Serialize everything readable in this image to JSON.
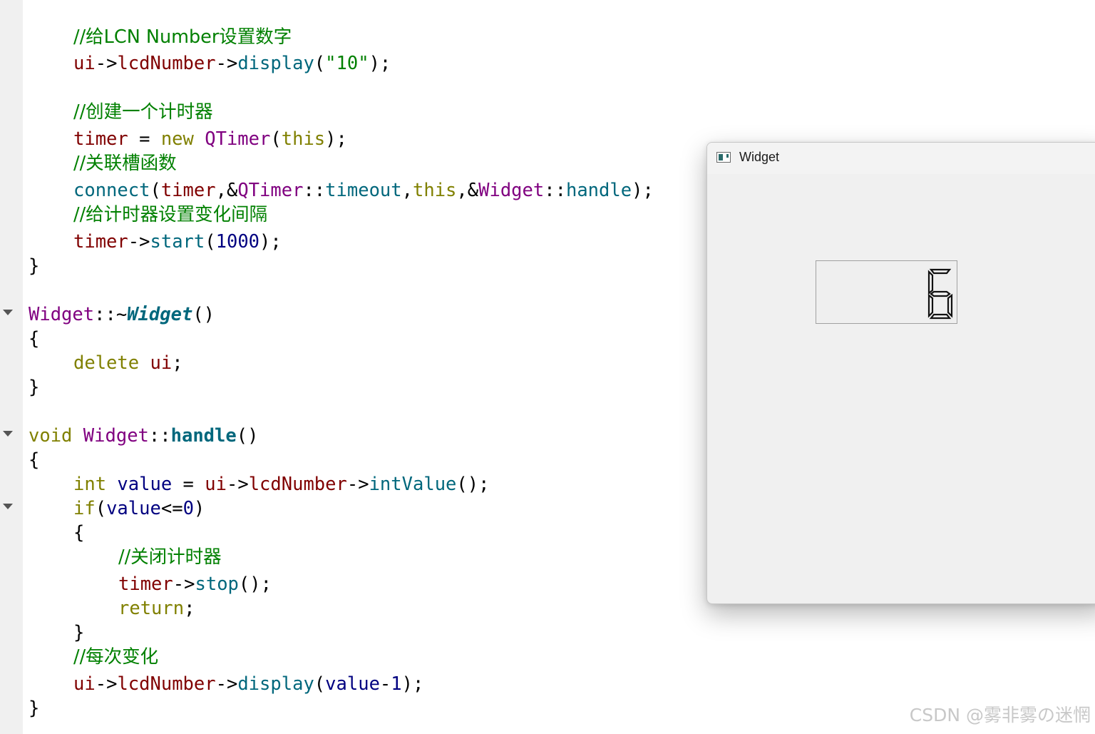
{
  "editor": {
    "comment_set_lcd": "//给LCN Number设置数字",
    "comment_create_timer": "//创建一个计时器",
    "comment_connect": "//关联槽函数",
    "comment_interval": "//给计时器设置变化间隔",
    "comment_close_timer": "//关闭计时器",
    "comment_each_change": "//每次变化",
    "display_arg": "\"10\"",
    "interval_ms": "1000",
    "zero": "0",
    "one": "1"
  },
  "window": {
    "title": "Widget",
    "lcd_value": "6"
  },
  "watermark": "CSDN @雾非雾の迷惘",
  "colors": {
    "keyword": "#808000",
    "comment": "#008000",
    "member": "#800000",
    "type": "#800080",
    "function": "#00677c",
    "number": "#000080"
  }
}
